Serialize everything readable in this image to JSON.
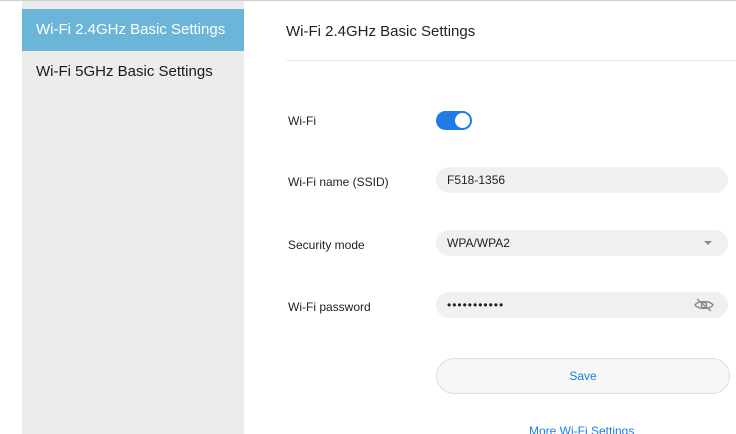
{
  "sidebar": {
    "items": [
      {
        "label": "Wi-Fi 2.4GHz Basic Settings",
        "active": true
      },
      {
        "label": "Wi-Fi 5GHz Basic Settings",
        "active": false
      }
    ]
  },
  "main": {
    "title": "Wi-Fi 2.4GHz Basic Settings",
    "wifi": {
      "label": "Wi-Fi",
      "enabled": true
    },
    "ssid": {
      "label": "Wi-Fi name (SSID)",
      "value": "F518-1356"
    },
    "security": {
      "label": "Security mode",
      "value": "WPA/WPA2"
    },
    "password": {
      "label": "Wi-Fi password",
      "masked_value": "•••••••••••"
    },
    "save_label": "Save",
    "more_link": "More Wi-Fi Settings"
  },
  "colors": {
    "active_sidebar": "#6bb6d8",
    "accent": "#1f7be6",
    "sidebar_bg": "#ececec",
    "field_bg": "#f0f0f0"
  },
  "icons": {
    "password_visibility": "eye-off-icon",
    "dropdown": "chevron-down-icon"
  }
}
